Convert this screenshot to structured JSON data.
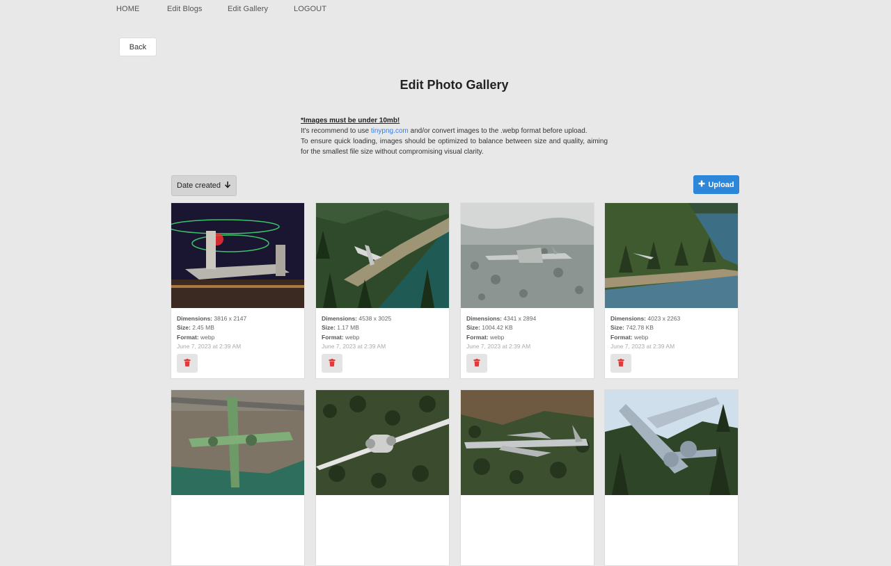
{
  "nav": {
    "home": "HOME",
    "edit_blogs": "Edit Blogs",
    "edit_gallery": "Edit Gallery",
    "logout": "LOGOUT"
  },
  "back_label": "Back",
  "page_title": "Edit Photo Gallery",
  "notice": {
    "warning": "*Images must be under 10mb!",
    "line1_pre": "It's recommend to use ",
    "link": "tinypng.com",
    "line1_post": " and/or convert images to the .webp format before upload.",
    "line2": "To ensure quick loading, images should be optimized to balance between size and quality, aiming for the smallest file size without compromising visual clarity."
  },
  "toolbar": {
    "sort_label": "Date created",
    "upload_label": "Upload"
  },
  "labels": {
    "dimensions": "Dimensions:",
    "size": "Size:",
    "format": "Format:"
  },
  "cards": [
    {
      "dimensions": "3816 x 2147",
      "size": "2.45 MB",
      "format": "webp",
      "date": "June 7, 2023 at 2:39 AM"
    },
    {
      "dimensions": "4538 x 3025",
      "size": "1.17 MB",
      "format": "webp",
      "date": "June 7, 2023 at 2:39 AM"
    },
    {
      "dimensions": "4341 x 2894",
      "size": "1004.42 KB",
      "format": "webp",
      "date": "June 7, 2023 at 2:39 AM"
    },
    {
      "dimensions": "4023 x 2263",
      "size": "742.78 KB",
      "format": "webp",
      "date": "June 7, 2023 at 2:39 AM"
    }
  ],
  "colors": {
    "background": "#e8e8e8",
    "accent": "#2e86d8",
    "delete": "#e03b3b",
    "link": "#3b7ddd"
  }
}
